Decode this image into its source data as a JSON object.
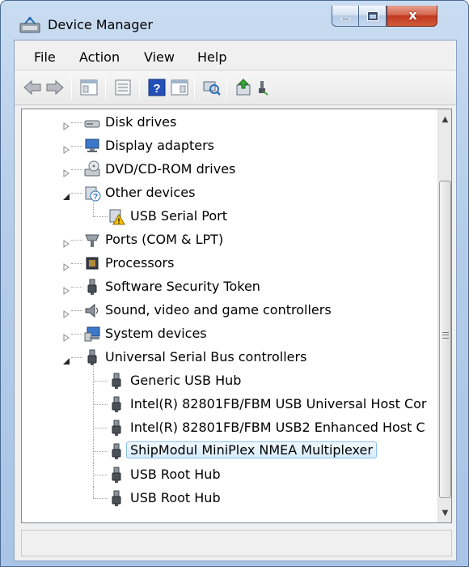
{
  "window": {
    "title": "Device Manager",
    "close_glyph": "x"
  },
  "menu": {
    "items": [
      "File",
      "Action",
      "View",
      "Help"
    ]
  },
  "toolbar": {
    "icons": [
      "back-arrow-icon",
      "forward-arrow-icon",
      "show-hide-tree-icon",
      "properties-icon",
      "help-icon",
      "console-tree-icon",
      "scan-hardware-icon",
      "update-driver-icon",
      "disable-device-icon"
    ]
  },
  "tree": {
    "items": [
      {
        "label": "Disk drives",
        "icon": "disk-drive-icon",
        "level": 0,
        "expanded": false
      },
      {
        "label": "Display adapters",
        "icon": "display-adapter-icon",
        "level": 0,
        "expanded": false
      },
      {
        "label": "DVD/CD-ROM drives",
        "icon": "dvd-drive-icon",
        "level": 0,
        "expanded": false
      },
      {
        "label": "Other devices",
        "icon": "other-devices-icon",
        "level": 0,
        "expanded": true
      },
      {
        "label": "USB Serial Port",
        "icon": "warning-device-icon",
        "level": 1
      },
      {
        "label": "Ports (COM & LPT)",
        "icon": "port-icon",
        "level": 0,
        "expanded": false
      },
      {
        "label": "Processors",
        "icon": "processor-icon",
        "level": 0,
        "expanded": false
      },
      {
        "label": "Software Security Token",
        "icon": "usb-plug-icon",
        "level": 0,
        "expanded": false
      },
      {
        "label": "Sound, video and game controllers",
        "icon": "speaker-icon",
        "level": 0,
        "expanded": false
      },
      {
        "label": "System devices",
        "icon": "system-device-icon",
        "level": 0,
        "expanded": false
      },
      {
        "label": "Universal Serial Bus controllers",
        "icon": "usb-plug-icon",
        "level": 0,
        "expanded": true
      },
      {
        "label": "Generic USB Hub",
        "icon": "usb-plug-icon",
        "level": 1
      },
      {
        "label": "Intel(R) 82801FB/FBM USB Universal Host Cor",
        "icon": "usb-plug-icon",
        "level": 1
      },
      {
        "label": "Intel(R) 82801FB/FBM USB2 Enhanced Host C",
        "icon": "usb-plug-icon",
        "level": 1
      },
      {
        "label": "ShipModul MiniPlex NMEA Multiplexer",
        "icon": "usb-plug-icon",
        "level": 1,
        "selected": true
      },
      {
        "label": "USB Root Hub",
        "icon": "usb-plug-icon",
        "level": 1
      },
      {
        "label": "USB Root Hub",
        "icon": "usb-plug-icon",
        "level": 1
      }
    ]
  },
  "scrollbar": {
    "up_arrow": "▲",
    "down_arrow": "▼"
  },
  "status": {
    "text": ""
  }
}
